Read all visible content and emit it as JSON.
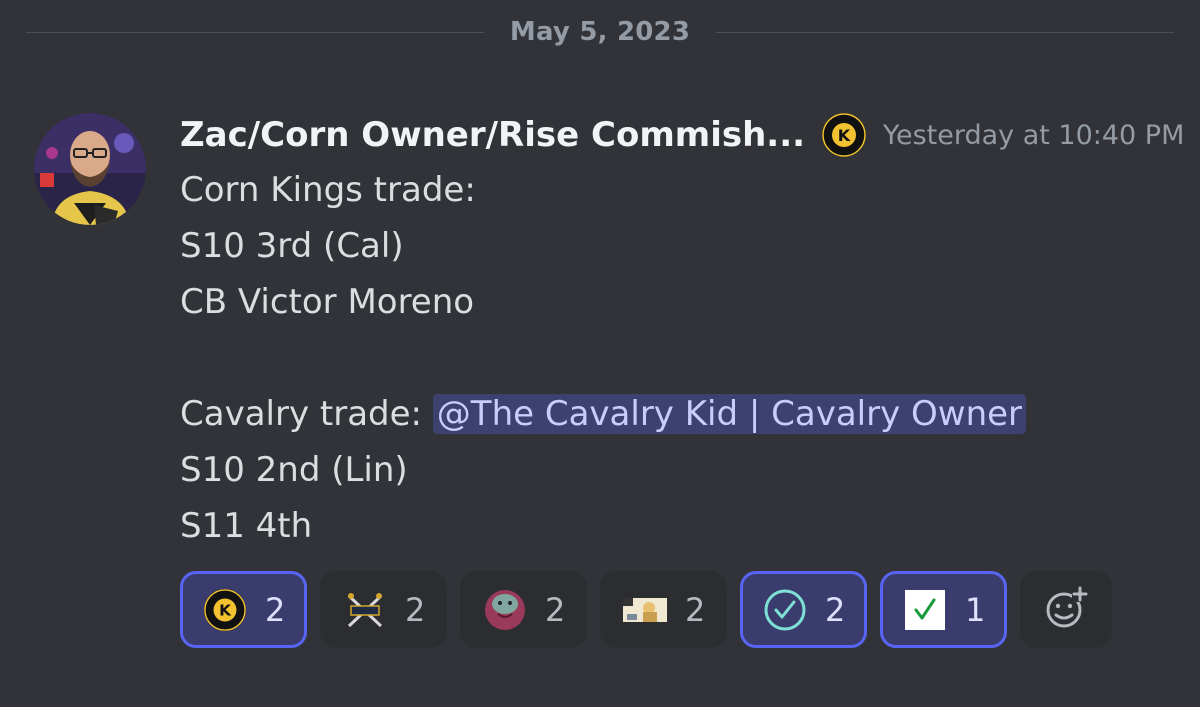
{
  "divider": {
    "date": "May 5, 2023"
  },
  "message": {
    "author": "Zac/Corn Owner/Rise Commish...",
    "timestamp": "Yesterday at 10:40 PM",
    "role_icon": "corn-kings-logo-icon",
    "lines": [
      "Corn Kings trade:",
      "S10 3rd (Cal)",
      "CB Victor Moreno",
      "",
      "Cavalry trade:",
      "S10 2nd (Lin)",
      "S11 4th"
    ],
    "mention": "@The Cavalry Kid | Cavalry Owner"
  },
  "reactions": [
    {
      "icon": "corn-kings-logo-icon",
      "count": "2",
      "selected": true
    },
    {
      "icon": "cavalry-swords-icon",
      "count": "2",
      "selected": false
    },
    {
      "icon": "face-emoji-icon",
      "count": "2",
      "selected": false
    },
    {
      "icon": "custom-image-emoji-icon",
      "count": "2",
      "selected": false
    },
    {
      "icon": "check-circle-icon",
      "count": "2",
      "selected": true
    },
    {
      "icon": "white-check-box-icon",
      "count": "1",
      "selected": true
    }
  ],
  "add_reaction_icon": "add-reaction-icon",
  "colors": {
    "background": "#313338",
    "accent": "#5865f2",
    "mention_bg": "#3c4270"
  }
}
